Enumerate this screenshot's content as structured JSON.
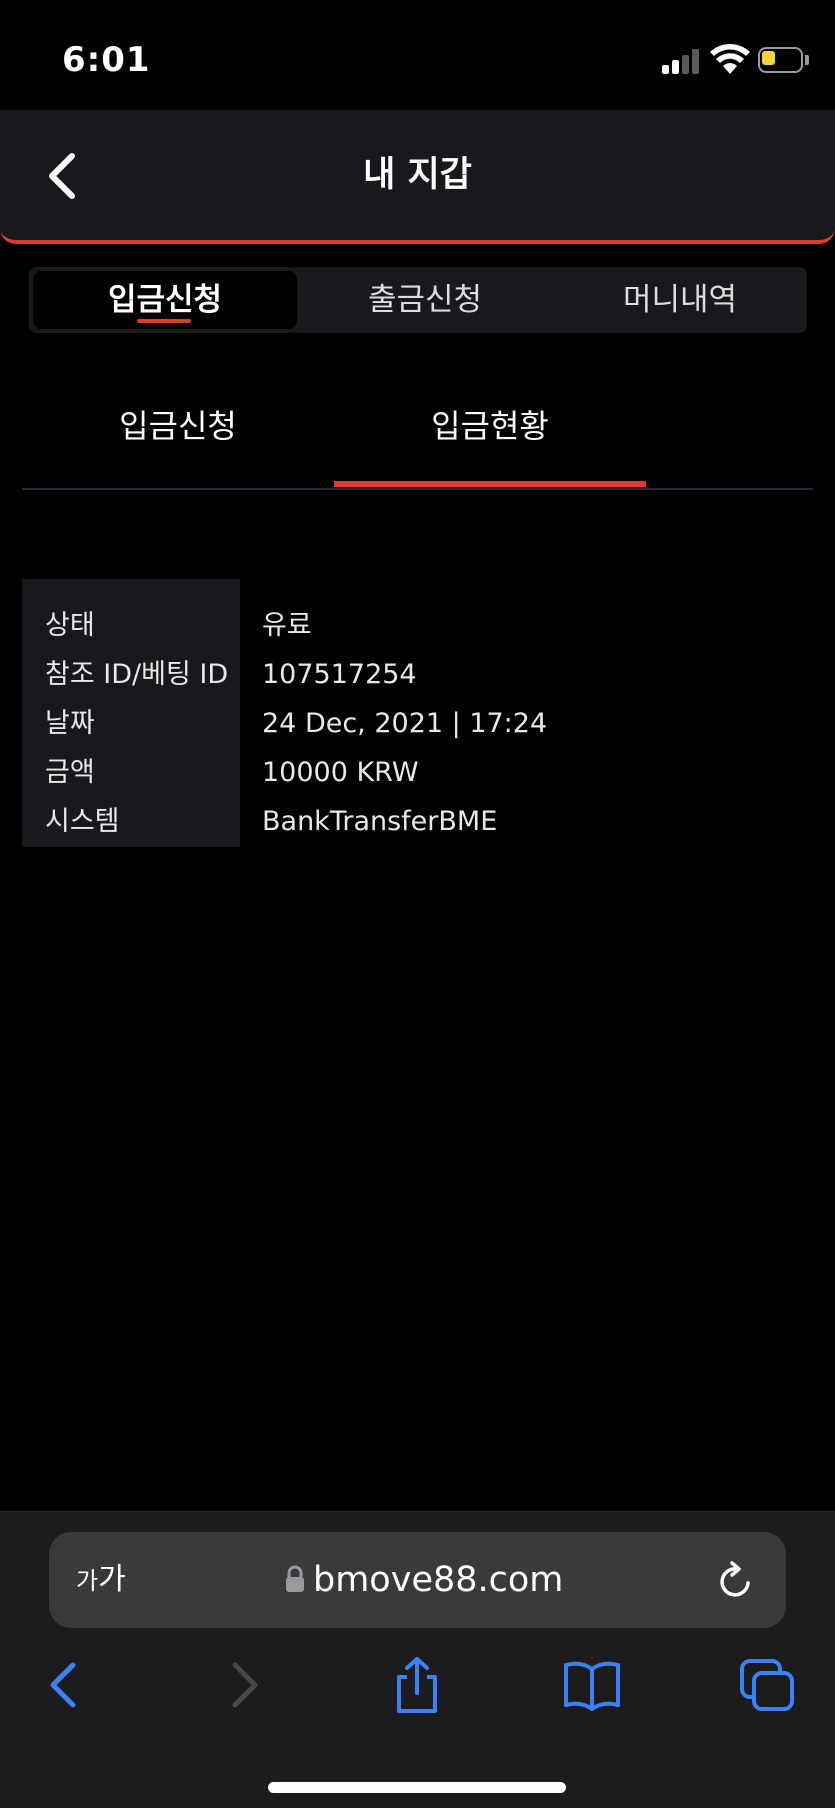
{
  "status_bar": {
    "time": "6:01"
  },
  "header": {
    "title": "내 지갑"
  },
  "segment_tabs": [
    {
      "label": "입금신청",
      "active": true
    },
    {
      "label": "출금신청",
      "active": false
    },
    {
      "label": "머니내역",
      "active": false
    }
  ],
  "sub_tabs": [
    {
      "label": "입금신청",
      "active": false
    },
    {
      "label": "입금현황",
      "active": true
    }
  ],
  "details": [
    {
      "label": "상태",
      "value": "유료"
    },
    {
      "label": "참조 ID/베팅 ID",
      "value": "107517254"
    },
    {
      "label": "날짜",
      "value": "24 Dec, 2021 | 17:24"
    },
    {
      "label": "금액",
      "value": "10000 KRW"
    },
    {
      "label": "시스템",
      "value": "BankTransferBME"
    }
  ],
  "browser": {
    "aa_small": "가",
    "aa_large": "가",
    "url": "bmove88.com"
  },
  "colors": {
    "accent": "#e23b2c",
    "panel": "#18191d",
    "background": "#000000",
    "safari_blue": "#3b82f6"
  },
  "icons": {
    "back": "chevron-left-icon",
    "lock": "lock-icon",
    "reload": "reload-icon",
    "share": "share-icon",
    "bookmarks": "book-icon",
    "tabs": "tabs-icon"
  }
}
